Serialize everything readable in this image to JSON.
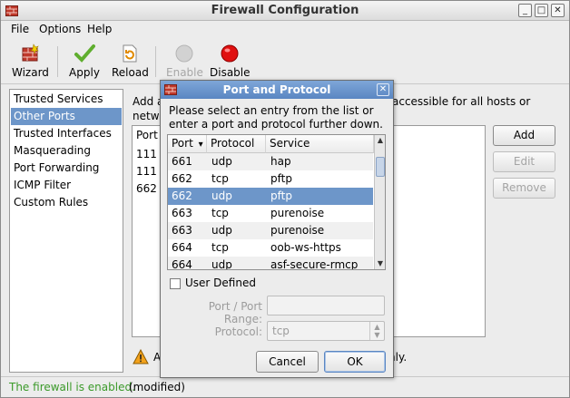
{
  "window": {
    "title": "Firewall Configuration",
    "btn_min": "_",
    "btn_max": "□",
    "btn_close": "✕"
  },
  "menu": [
    "File",
    "Options",
    "Help"
  ],
  "toolbar": {
    "wizard": "Wizard",
    "apply": "Apply",
    "reload": "Reload",
    "enable": "Enable",
    "disable": "Disable"
  },
  "sidebar": {
    "items": [
      "Trusted Services",
      "Other Ports",
      "Trusted Interfaces",
      "Masquerading",
      "Port Forwarding",
      "ICMP Filter",
      "Custom Rules"
    ],
    "selected": "Other Ports"
  },
  "main": {
    "intro_left_l1": "Add a",
    "intro_left_l2": "netw",
    "intro_right": "accessible for all hosts or",
    "list_header": "Port",
    "list_rows": [
      "111",
      "111",
      "662"
    ],
    "buttons": {
      "add": "Add",
      "edit": "Edit",
      "remove": "Remove"
    },
    "warning_left": "A",
    "warning_right": "nly."
  },
  "status": {
    "enabled": "The firewall is enabled.",
    "modified": "(modified)"
  },
  "dialog": {
    "title": "Port and Protocol",
    "close": "✕",
    "message": "Please select an entry from the list or enter a port and protocol further down.",
    "columns": {
      "port": "Port",
      "protocol": "Protocol",
      "service": "Service",
      "sort": "▾"
    },
    "rows": [
      {
        "port": "661",
        "protocol": "udp",
        "service": "hap"
      },
      {
        "port": "662",
        "protocol": "tcp",
        "service": "pftp"
      },
      {
        "port": "662",
        "protocol": "udp",
        "service": "pftp"
      },
      {
        "port": "663",
        "protocol": "tcp",
        "service": "purenoise"
      },
      {
        "port": "663",
        "protocol": "udp",
        "service": "purenoise"
      },
      {
        "port": "664",
        "protocol": "tcp",
        "service": "oob-ws-https"
      },
      {
        "port": "664",
        "protocol": "udp",
        "service": "asf-secure-rmcp"
      }
    ],
    "selected_row_index": 2,
    "user_defined": "User Defined",
    "port_range_label": "Port / Port Range:",
    "protocol_label": "Protocol:",
    "protocol_value": "tcp",
    "cancel": "Cancel",
    "ok": "OK"
  },
  "colors": {
    "selection": "#6d96c9",
    "status_ok": "#3b9a2a",
    "dialog_title": "#5a86c2"
  }
}
